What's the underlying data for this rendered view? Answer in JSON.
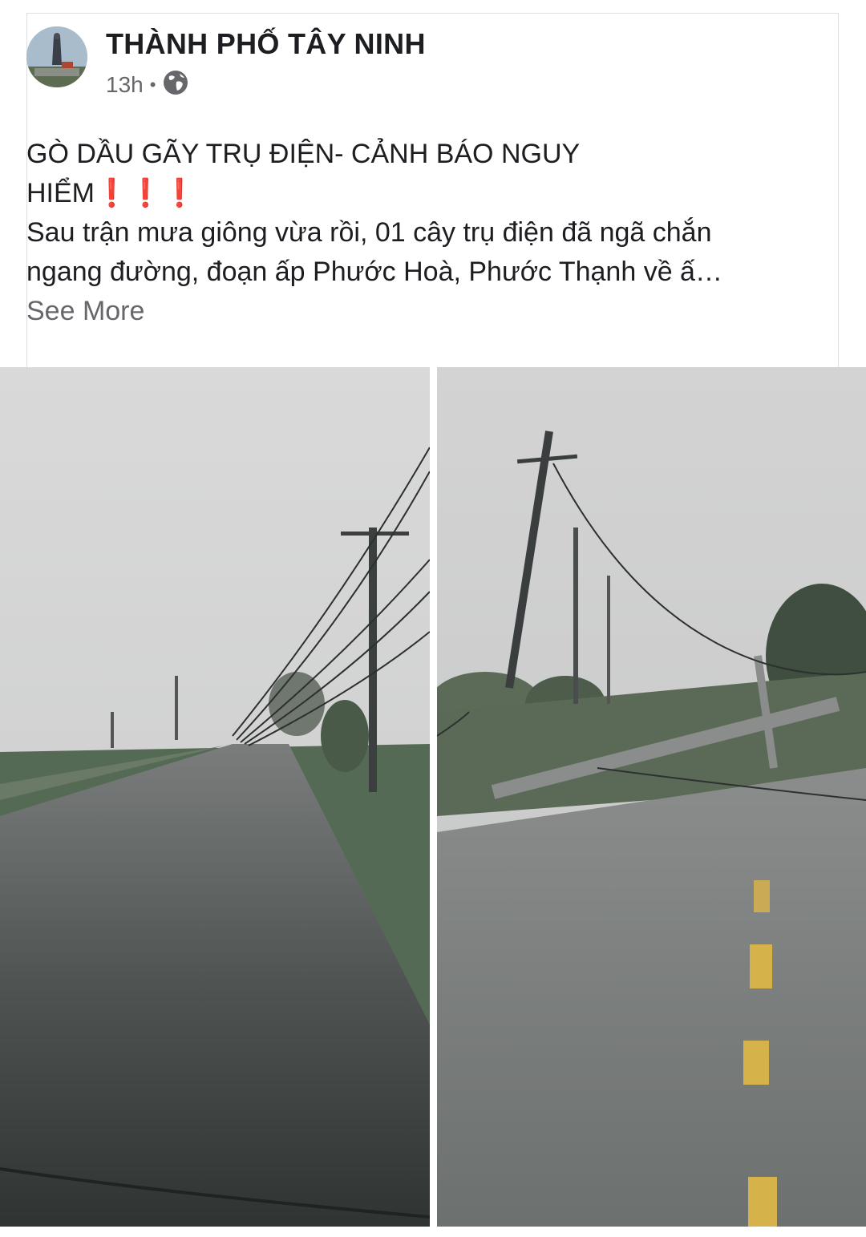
{
  "post": {
    "page_name": "THÀNH PHỐ TÂY NINH",
    "time": "13h",
    "separator": "•",
    "privacy_icon": "globe-icon",
    "headline_line1": "GÒ DẦU GÃY TRỤ ĐIỆN- CẢNH BÁO NGUY",
    "headline_line2": "HIỂM",
    "alert_emojis": "❗❗❗",
    "body_line1": "Sau trận mưa giông vừa rồi, 01 cây trụ điện đã ngã chắn",
    "body_line2": "ngang đường, đoạn ấp Phước Hoà, Phước Thạnh về ấ…",
    "see_more": "See More"
  },
  "colors": {
    "text_primary": "#1c1e21",
    "text_secondary": "#65676b",
    "alert_red": "#e0245e"
  }
}
